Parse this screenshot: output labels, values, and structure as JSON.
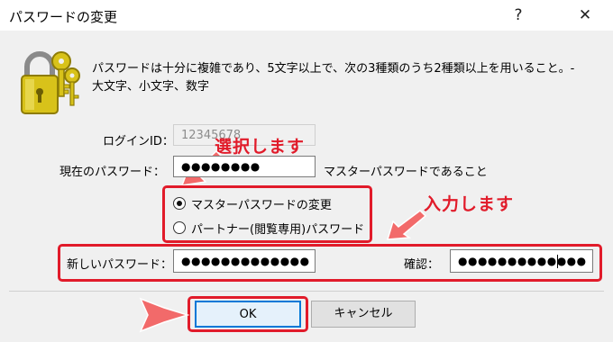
{
  "window": {
    "title": "パスワードの変更",
    "help_symbol": "?",
    "close_symbol": "✕"
  },
  "info": {
    "line1": "パスワードは十分に複雑であり、5文字以上で、次の3種類のうち2種類以上を用いること。-",
    "line2": "大文字、小文字、数字"
  },
  "login": {
    "label": "ログインID：",
    "value": "12345678"
  },
  "current_password": {
    "label": "現在のパスワード：",
    "value": "●●●●●●●●",
    "hint": "マスターパスワードであること"
  },
  "options": [
    {
      "label": "マスターパスワードの変更",
      "checked": true
    },
    {
      "label": "パートナー(閲覧専用)パスワード",
      "checked": false
    }
  ],
  "new_password": {
    "label": "新しいパスワード：",
    "value": "●●●●●●●●●●●●●"
  },
  "confirm": {
    "label": "確認：",
    "value": "●●●●●●●●●●●●●"
  },
  "buttons": {
    "ok": "OK",
    "cancel": "キャンセル"
  },
  "annotations": {
    "select": "選択します",
    "input": "入力します"
  },
  "colors": {
    "highlight": "#e11b2a",
    "arrow": "#f26a6a"
  },
  "icon": "lock-and-keys-icon"
}
